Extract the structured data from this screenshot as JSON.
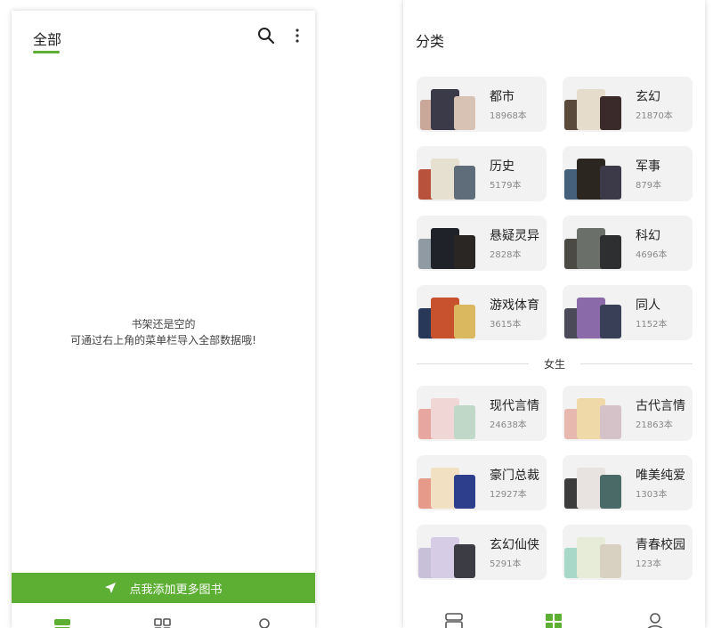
{
  "left": {
    "tab_label": "全部",
    "empty_line1": "书架还是空的",
    "empty_line2": "可通过右上角的菜单栏导入全部数据哦!",
    "add_bar_label": "点我添加更多图书",
    "accent_color": "#5daf34"
  },
  "right": {
    "section_title": "分类",
    "male_categories": [
      {
        "name": "都市",
        "count": "18968本"
      },
      {
        "name": "玄幻",
        "count": "21870本"
      },
      {
        "name": "历史",
        "count": "5179本"
      },
      {
        "name": "军事",
        "count": "879本"
      },
      {
        "name": "悬疑灵异",
        "count": "2828本"
      },
      {
        "name": "科幻",
        "count": "4696本"
      },
      {
        "name": "游戏体育",
        "count": "3615本"
      },
      {
        "name": "同人",
        "count": "1152本"
      }
    ],
    "divider_label": "女生",
    "female_categories": [
      {
        "name": "现代言情",
        "count": "24638本"
      },
      {
        "name": "古代言情",
        "count": "21863本"
      },
      {
        "name": "豪门总裁",
        "count": "12927本"
      },
      {
        "name": "唯美纯爱",
        "count": "1303本"
      },
      {
        "name": "玄幻仙侠",
        "count": "5291本"
      },
      {
        "name": "青春校园",
        "count": "123本"
      }
    ]
  },
  "icons": {
    "search": "search-icon",
    "more": "more-vertical-icon",
    "navigate": "navigate-arrow-icon",
    "bookshelf": "bookshelf-icon",
    "category": "grid-icon",
    "profile": "person-icon"
  }
}
